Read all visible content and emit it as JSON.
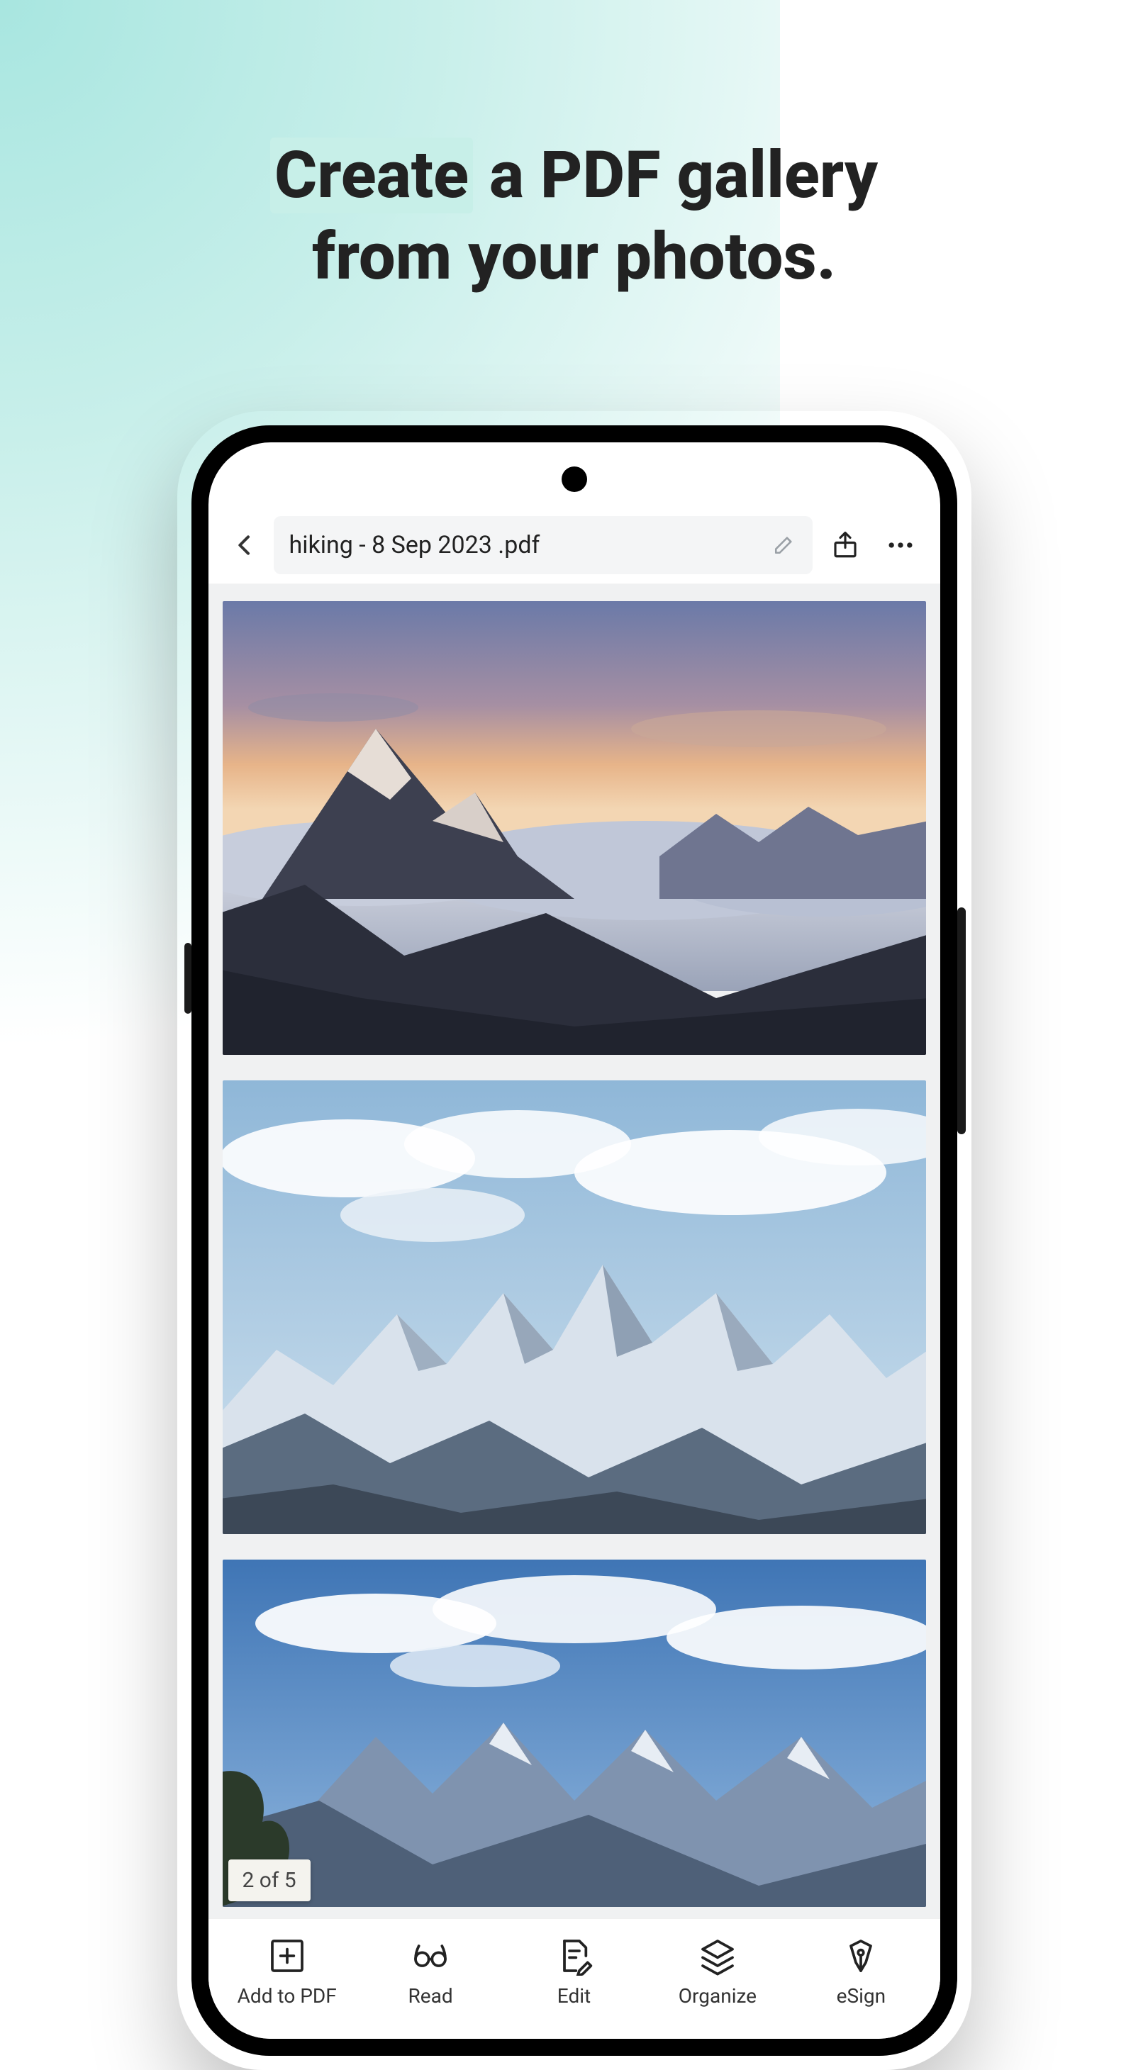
{
  "headline": {
    "line1_pre": "Create",
    "line1_post": " a PDF gallery",
    "line2": "from your photos."
  },
  "topbar": {
    "filename": "hiking - 8 Sep 2023 .pdf"
  },
  "page_indicator": "2 of 5",
  "toolbar": {
    "add_label": "Add to PDF",
    "read_label": "Read",
    "edit_label": "Edit",
    "organize_label": "Organize",
    "esign_label": "eSign"
  }
}
